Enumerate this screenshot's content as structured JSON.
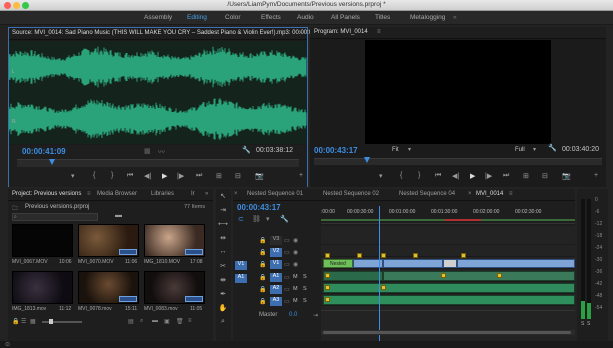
{
  "window": {
    "title": "/Users/LiamPym/Documents/Previous versions.prproj *"
  },
  "workspaces": [
    "Assembly",
    "Editing",
    "Color",
    "Effects",
    "Audio",
    "All Panels",
    "Titles",
    "Metalogging"
  ],
  "active_workspace": "Editing",
  "source": {
    "title": "Source: MVI_0014: Sad Piano Music (THIS WILL MAKE YOU CRY – Saddest Piano & Violin Ever!).mp3: 00:00:02:0",
    "current_tc": "00:00:41:09",
    "duration_tc": "00:03:38:12",
    "waveform_color": "#2aa37a"
  },
  "program": {
    "title": "Program: MVI_0014",
    "current_tc": "00:00:43:17",
    "fit": "Fit",
    "quality": "Full",
    "duration_tc": "00:03:40:20"
  },
  "project": {
    "tabs": [
      "Project: Previous versions",
      "Media Browser",
      "Libraries",
      "Ir"
    ],
    "file": "Previous versions.prproj",
    "item_count": "77 Items",
    "clips": [
      {
        "name": "MVI_0067.MOV",
        "duration": "10:06"
      },
      {
        "name": "MVI_0070.MOV",
        "duration": "11:06"
      },
      {
        "name": "IMG_1810.MOV",
        "duration": "17:08"
      },
      {
        "name": "IMG_1813.mov",
        "duration": "11:12"
      },
      {
        "name": "MVI_0078.mov",
        "duration": "15:11"
      },
      {
        "name": "MVI_0083.mov",
        "duration": "11:05"
      }
    ]
  },
  "timeline": {
    "tabs": [
      "Nested Sequence 01",
      "Nested Sequence 02",
      "Nested Sequence 04",
      "MVI_0014"
    ],
    "active_tab": "MVI_0014",
    "current_tc": "00:00:43:17",
    "ruler": [
      ":00:00",
      "00:00:30:00",
      "00:01:00:00",
      "00:01:30:00",
      "00:02:00:00",
      "00:02:30:00"
    ],
    "video_tracks": [
      "V3",
      "V2",
      "V1"
    ],
    "audio_tracks": [
      "A1",
      "A2",
      "A3"
    ],
    "source_patch": [
      "V1",
      "A1"
    ],
    "nested_label": "Nested",
    "mute": "M",
    "solo": "S",
    "master_label": "Master",
    "master_value": "0.0"
  },
  "meter": {
    "scale": [
      "0",
      "-6",
      "-12",
      "-18",
      "-24",
      "-30",
      "-36",
      "-42",
      "-48",
      "-54"
    ],
    "footer": [
      "S",
      "S"
    ]
  }
}
